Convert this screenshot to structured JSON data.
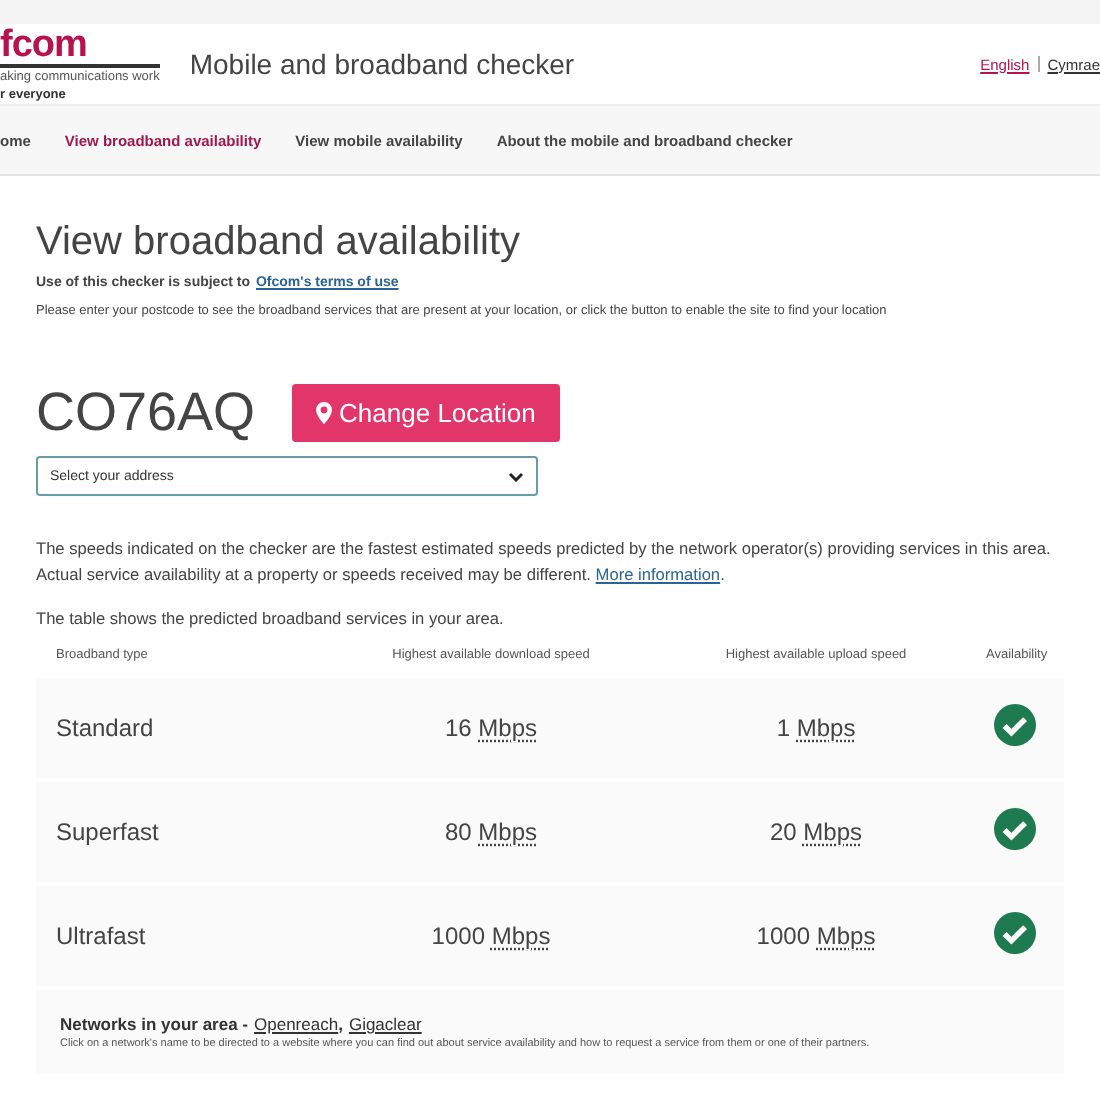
{
  "header": {
    "logo": "fcom",
    "tagline": [
      "aking communications work",
      "r everyone"
    ],
    "title": "Mobile and broadband checker",
    "languages": [
      {
        "label": "English",
        "selected": true
      },
      {
        "label": "Cymrae",
        "selected": false
      }
    ]
  },
  "nav": [
    {
      "label": "ome",
      "selected": false
    },
    {
      "label": "View broadband availability",
      "selected": true
    },
    {
      "label": "View mobile availability",
      "selected": false
    },
    {
      "label": "About the mobile and broadband checker",
      "selected": false
    }
  ],
  "page": {
    "heading": "View broadband availability",
    "terms_text": "Use of this checker is subject to",
    "terms_link": "Ofcom's terms of use",
    "intro": "Please enter your postcode to see the broadband services that are present at your location, or click the button to enable the site to find your location",
    "postcode": "CO76AQ",
    "change_button": "Change Location",
    "address_select": {
      "value": "Select your address"
    },
    "disclaimer": "The speeds indicated on the checker are the fastest estimated speeds predicted by the network operator(s) providing services in this area. Actual service availability at a property or speeds received may be different.",
    "disclaimer_link": "More information",
    "disclaimer_end": ".",
    "table_intro": "The table shows the predicted broadband services in your area."
  },
  "table": {
    "columns": [
      "Broadband type",
      "Highest available download speed",
      "Highest available upload speed",
      "Availability"
    ],
    "rows": [
      {
        "type": "Standard",
        "download": "16",
        "download_unit": "Mbps",
        "upload": "1",
        "upload_unit": "Mbps",
        "available": true
      },
      {
        "type": "Superfast",
        "download": "80",
        "download_unit": "Mbps",
        "upload": "20",
        "upload_unit": "Mbps",
        "available": true
      },
      {
        "type": "Ultrafast",
        "download": "1000",
        "download_unit": "Mbps",
        "upload": "1000",
        "upload_unit": "Mbps",
        "available": true
      }
    ]
  },
  "networks": {
    "label": "Networks in your area -",
    "links": [
      "Openreach",
      "Gigaclear"
    ],
    "separator": ",",
    "note": "Click on a network's name to be directed to a website where you can find out about service availability and how to request a service from them or one of their partners."
  }
}
